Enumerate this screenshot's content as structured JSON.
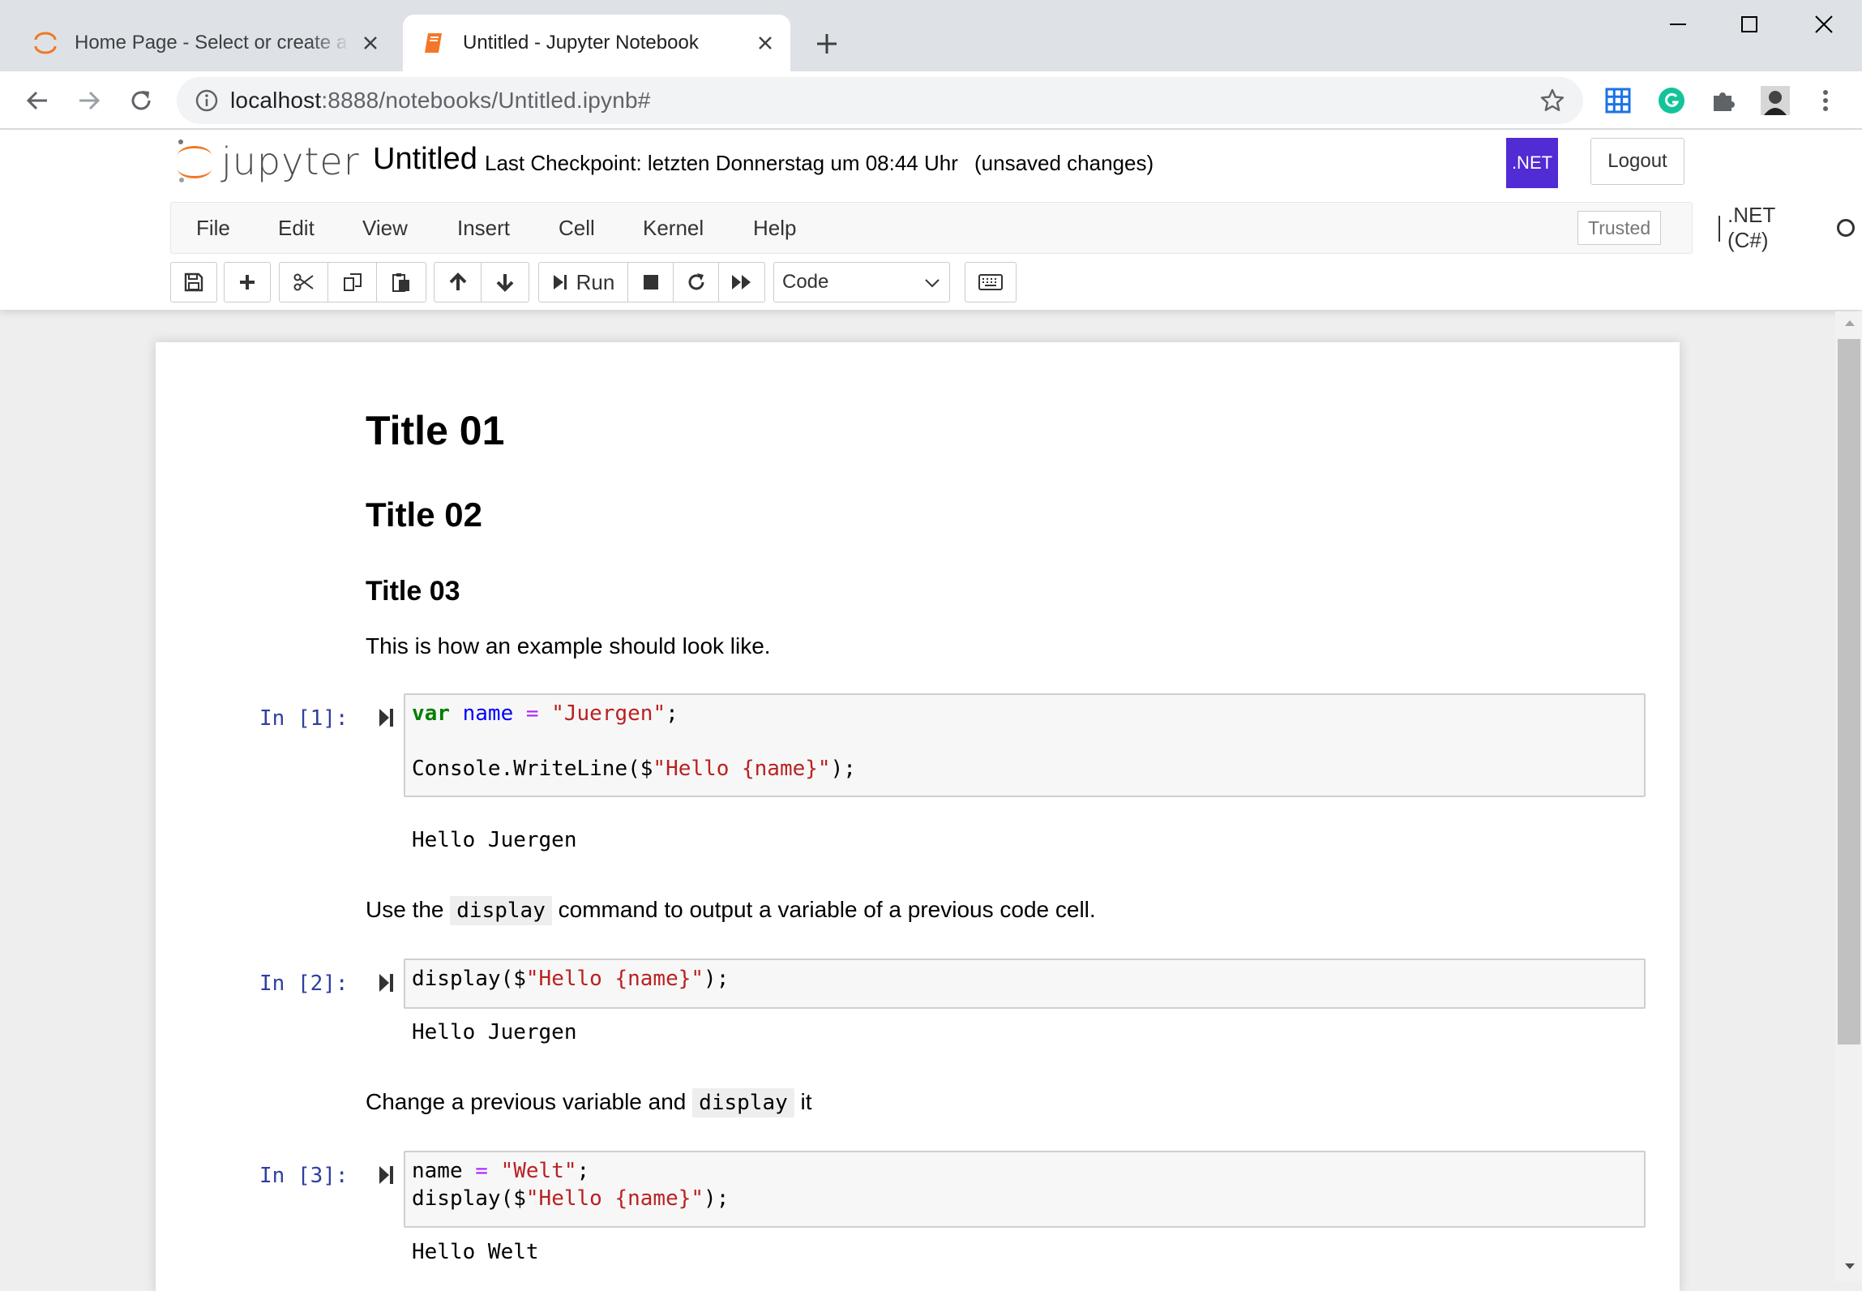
{
  "browser": {
    "tabs": [
      {
        "title": "Home Page - Select or create a new notebook",
        "active": false
      },
      {
        "title": "Untitled - Jupyter Notebook",
        "active": true
      }
    ],
    "url": {
      "host": "localhost",
      "path": ":8888/notebooks/Untitled.ipynb#"
    }
  },
  "jupyter": {
    "logo_text": "jupyter",
    "notebook_name": "Untitled",
    "checkpoint": "Last Checkpoint: letzten Donnerstag um 08:44 Uhr",
    "autosave": "(unsaved changes)",
    "kernel_badge": ".NET",
    "logout": "Logout",
    "menu": [
      "File",
      "Edit",
      "View",
      "Insert",
      "Cell",
      "Kernel",
      "Help"
    ],
    "trusted": "Trusted",
    "kernel_name": ".NET (C#)",
    "run_label": "Run",
    "cell_type": "Code",
    "colors": {
      "badge": "#512bd4",
      "prompt": "#303f9f"
    }
  },
  "cells": {
    "h1": "Title 01",
    "h2": "Title 02",
    "h3": "Title 03",
    "intro": "This is how an example should look like.",
    "c1": {
      "prompt": "In [1]:",
      "line1": {
        "kw": "var",
        "name": "name",
        "op": "=",
        "str": "\"Juergen\"",
        "end": ";"
      },
      "line3": {
        "pre": "Console.WriteLine($",
        "str": "\"Hello {name}\"",
        "end": ");"
      },
      "output": "Hello Juergen"
    },
    "m2": {
      "pre": "Use the",
      "code": "display",
      "post": "command to output a variable of a previous code cell."
    },
    "c2": {
      "prompt": "In [2]:",
      "line1": {
        "pre": "display($",
        "str": "\"Hello {name}\"",
        "end": ");"
      },
      "output": "Hello Juergen"
    },
    "m3": {
      "pre": "Change a previous variable and",
      "code": "display",
      "post": "it"
    },
    "c3": {
      "prompt": "In [3]:",
      "line1": {
        "name": "name",
        "op": "=",
        "str": "\"Welt\"",
        "end": ";"
      },
      "line2": {
        "pre": "display($",
        "str": "\"Hello {name}\"",
        "end": ");"
      },
      "output": "Hello Welt"
    }
  }
}
